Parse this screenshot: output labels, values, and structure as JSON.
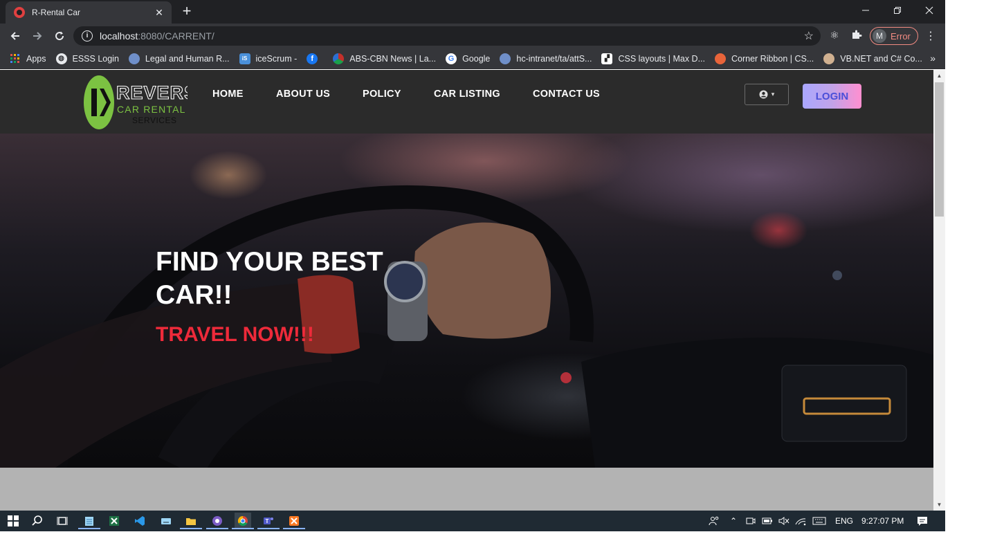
{
  "browser": {
    "tab_title": "R-Rental Car",
    "tab_close": "✕",
    "new_tab": "+",
    "window_controls": {
      "minimize": "—",
      "maximize": "❐",
      "close": "✕"
    },
    "url_host": "localhost",
    "url_rest": ":8080/CARRENT/",
    "profile_initial": "M",
    "profile_status": "Error",
    "bookmarks": [
      {
        "label": "Apps",
        "icon": "apps-grid-icon",
        "color": "#e8eaed"
      },
      {
        "label": "ESSS Login",
        "icon": "globe-icon",
        "color": "#e8eaed"
      },
      {
        "label": "Legal and Human R...",
        "icon": "seal-icon",
        "color": "#6f8fc9"
      },
      {
        "label": "iceScrum -",
        "icon": "icescrum-icon",
        "color": "#4a90d9"
      },
      {
        "label": "",
        "icon": "facebook-icon",
        "color": "#1877f2"
      },
      {
        "label": "ABS-CBN News | La...",
        "icon": "abscbn-icon",
        "color": "#c4302b"
      },
      {
        "label": "Google",
        "icon": "google-icon",
        "color": "#ffffff"
      },
      {
        "label": "hc-intranet/ta/attS...",
        "icon": "seal-icon",
        "color": "#6f8fc9"
      },
      {
        "label": "CSS layouts | Max D...",
        "icon": "css-layouts-icon",
        "color": "#ffffff"
      },
      {
        "label": "Corner Ribbon | CS...",
        "icon": "codepen-icon",
        "color": "#e8643a"
      },
      {
        "label": "VB.NET and C# Co...",
        "icon": "vb-icon",
        "color": "#d0b090"
      }
    ],
    "bookmarks_more": "»"
  },
  "site": {
    "logo_text_top": "REVERSE",
    "logo_text_mid": "CAR RENTAL",
    "logo_text_bottom": "SERVICES",
    "nav": [
      "HOME",
      "ABOUT US",
      "POLICY",
      "CAR LISTING",
      "CONTACT US"
    ],
    "account_caret": "▾",
    "login_label": "LOGIN",
    "hero_title": "FIND YOUR BEST CAR!!",
    "hero_subtitle": "TRAVEL NOW!!!"
  },
  "taskbar": {
    "language": "ENG",
    "time": "9:27:07 PM"
  },
  "colors": {
    "accent_red": "#ee2a3a",
    "logo_green": "#7cc242",
    "login_gradient_start": "#a9a7ff",
    "login_gradient_end": "#ff8fd0"
  }
}
